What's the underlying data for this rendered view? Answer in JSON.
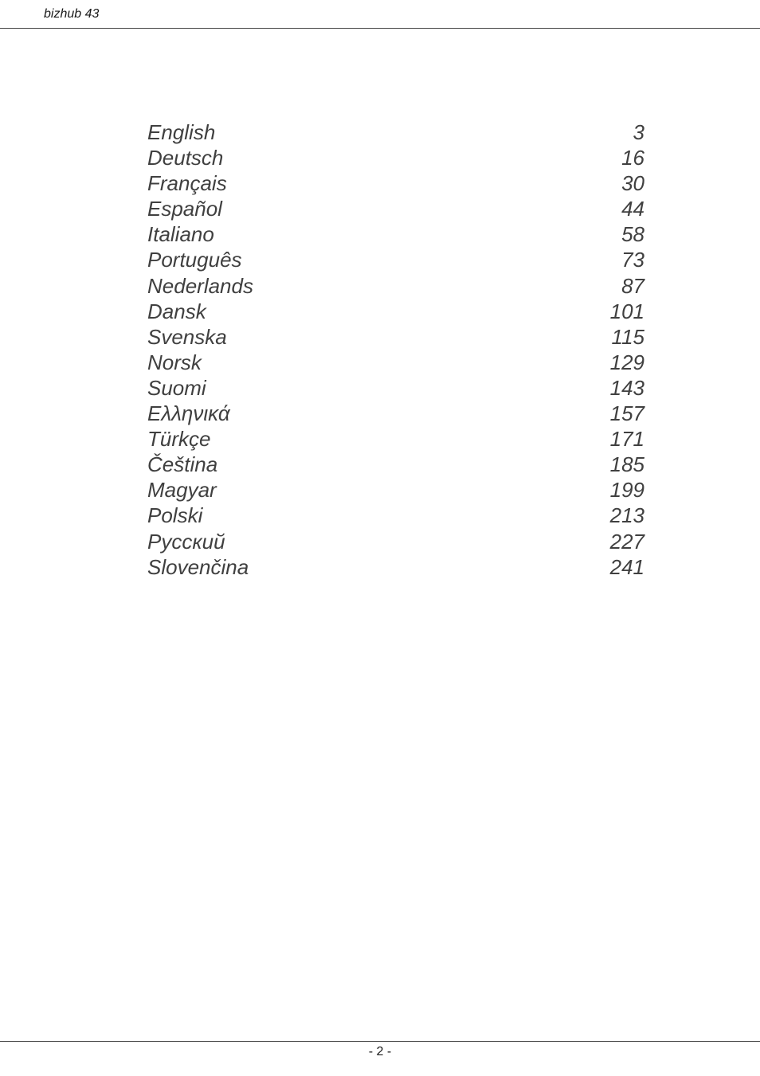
{
  "header": {
    "title": "bizhub 43"
  },
  "toc": [
    {
      "language": "English",
      "page": "3"
    },
    {
      "language": "Deutsch",
      "page": "16"
    },
    {
      "language": "Français",
      "page": "30"
    },
    {
      "language": "Español",
      "page": "44"
    },
    {
      "language": "Italiano",
      "page": "58"
    },
    {
      "language": "Português",
      "page": "73"
    },
    {
      "language": "Nederlands",
      "page": "87"
    },
    {
      "language": "Dansk",
      "page": "101"
    },
    {
      "language": "Svenska",
      "page": "115"
    },
    {
      "language": "Norsk",
      "page": "129"
    },
    {
      "language": "Suomi",
      "page": "143"
    },
    {
      "language": "Ελληνικά",
      "page": "157"
    },
    {
      "language": "Türkçe",
      "page": "171"
    },
    {
      "language": "Čeština",
      "page": "185"
    },
    {
      "language": "Magyar",
      "page": "199"
    },
    {
      "language": "Polski",
      "page": "213"
    },
    {
      "language": "Русский",
      "page": "227"
    },
    {
      "language": "Slovenčina",
      "page": "241"
    }
  ],
  "footer": {
    "page_number": "- 2 -"
  }
}
